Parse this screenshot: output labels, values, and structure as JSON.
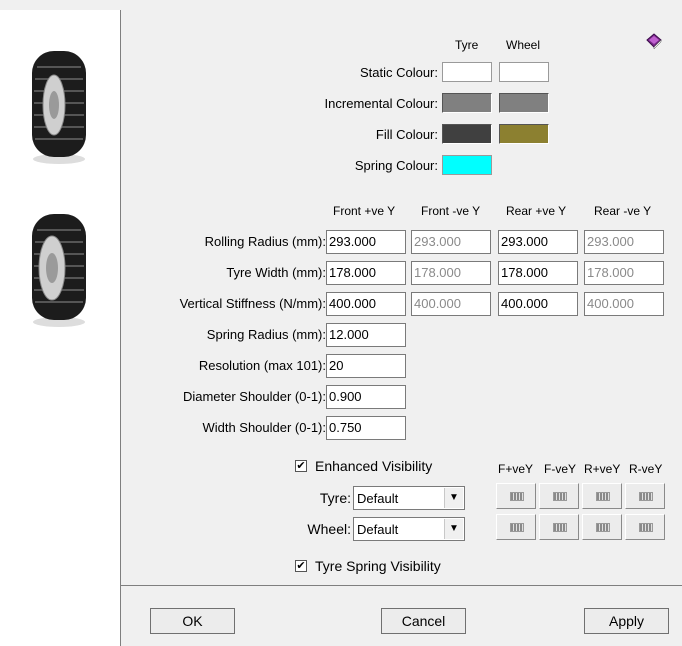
{
  "colours": {
    "headers": {
      "tyre": "Tyre",
      "wheel": "Wheel"
    },
    "static": {
      "label": "Static Colour:",
      "tyre": "#ffffff",
      "wheel": "#ffffff"
    },
    "incremental": {
      "label": "Incremental Colour:",
      "tyre": "#808080",
      "wheel": "#808080"
    },
    "fill": {
      "label": "Fill Colour:",
      "tyre": "#404040",
      "wheel": "#8c8030"
    },
    "spring": {
      "label": "Spring Colour:",
      "tyre": "#00ffff"
    }
  },
  "columns": [
    "Front +ve Y",
    "Front -ve Y",
    "Rear +ve Y",
    "Rear -ve Y"
  ],
  "rows": [
    {
      "label": "Rolling Radius (mm):",
      "values": [
        "293.000",
        "293.000",
        "293.000",
        "293.000"
      ]
    },
    {
      "label": "Tyre Width (mm):",
      "values": [
        "178.000",
        "178.000",
        "178.000",
        "178.000"
      ]
    },
    {
      "label": "Vertical Stiffness (N/mm):",
      "values": [
        "400.000",
        "400.000",
        "400.000",
        "400.000"
      ]
    }
  ],
  "single_fields": [
    {
      "label": "Spring Radius (mm):",
      "value": "12.000"
    },
    {
      "label": "Resolution (max 101):",
      "value": "20"
    },
    {
      "label": "Diameter Shoulder (0-1):",
      "value": "0.900"
    },
    {
      "label": "Width Shoulder (0-1):",
      "value": "0.750"
    }
  ],
  "enhanced_visibility": {
    "label": "Enhanced Visibility",
    "checked": true,
    "check_glyph": "✔"
  },
  "tyre_select": {
    "label": "Tyre:",
    "value": "Default"
  },
  "wheel_select": {
    "label": "Wheel:",
    "value": "Default"
  },
  "tyre_spring_visibility": {
    "label": "Tyre Spring Visibility",
    "checked": true,
    "check_glyph": "✔"
  },
  "vis_columns": [
    "F+veY",
    "F-veY",
    "R+veY",
    "R-veY"
  ],
  "buttons": {
    "ok": "OK",
    "cancel": "Cancel",
    "apply": "Apply"
  },
  "icons": {
    "help": "help-book-icon",
    "arrow": "▼"
  }
}
